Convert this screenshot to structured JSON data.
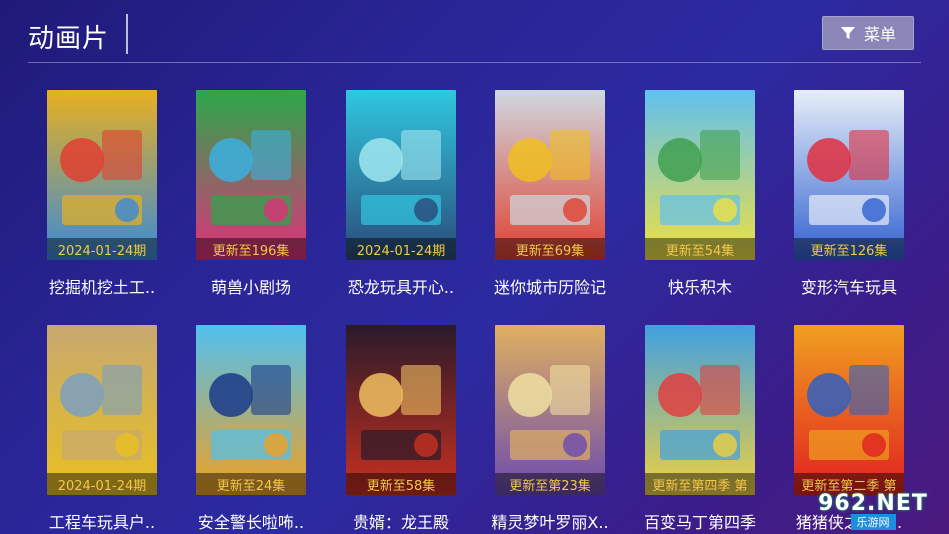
{
  "header": {
    "title": "动画片",
    "menu_label": "菜单"
  },
  "items": [
    {
      "badge": "2024-01-24期",
      "name": "挖掘机挖土工..",
      "colors": [
        "#e8b020",
        "#3a8ad8",
        "#e04030"
      ]
    },
    {
      "badge": "更新至196集",
      "name": "萌兽小剧场",
      "colors": [
        "#2aa84a",
        "#e0307a",
        "#3ab0e0"
      ]
    },
    {
      "badge": "2024-01-24期",
      "name": "恐龙玩具开心..",
      "colors": [
        "#30c8e0",
        "#2a4a7a",
        "#a0e8f0"
      ]
    },
    {
      "badge": "更新至69集",
      "name": "迷你城市历险记",
      "colors": [
        "#cfd8e0",
        "#e04030",
        "#f0c020"
      ]
    },
    {
      "badge": "更新至54集",
      "name": "快乐积木",
      "colors": [
        "#60c0f0",
        "#f0e040",
        "#40a050"
      ]
    },
    {
      "badge": "更新至126集",
      "name": "变形汽车玩具",
      "colors": [
        "#e8eef8",
        "#3060d0",
        "#e03040"
      ]
    },
    {
      "badge": "2024-01-24期",
      "name": "工程车玩具户..",
      "colors": [
        "#c8a870",
        "#e8c020",
        "#7aa0c0"
      ]
    },
    {
      "badge": "更新至24集",
      "name": "安全警长啦咘..",
      "colors": [
        "#50c0f0",
        "#f0a020",
        "#1a3a8a"
      ]
    },
    {
      "badge": "更新至58集",
      "name": "贵婿：龙王殿",
      "colors": [
        "#2a1a2a",
        "#c83020",
        "#f0c060"
      ]
    },
    {
      "badge": "更新至第23集",
      "name": "精灵梦叶罗丽X..",
      "colors": [
        "#e0b060",
        "#6a4ab0",
        "#f0e0a0"
      ]
    },
    {
      "badge": "更新至第四季 第",
      "name": "百变马丁第四季",
      "colors": [
        "#40a0e0",
        "#f0d040",
        "#e04040"
      ]
    },
    {
      "badge": "更新至第二季 第",
      "name": "猪猪侠之竞球..",
      "colors": [
        "#f0a020",
        "#e02020",
        "#3060c0"
      ]
    }
  ],
  "watermark": {
    "top": "962.NET",
    "bottom": "乐游网"
  }
}
